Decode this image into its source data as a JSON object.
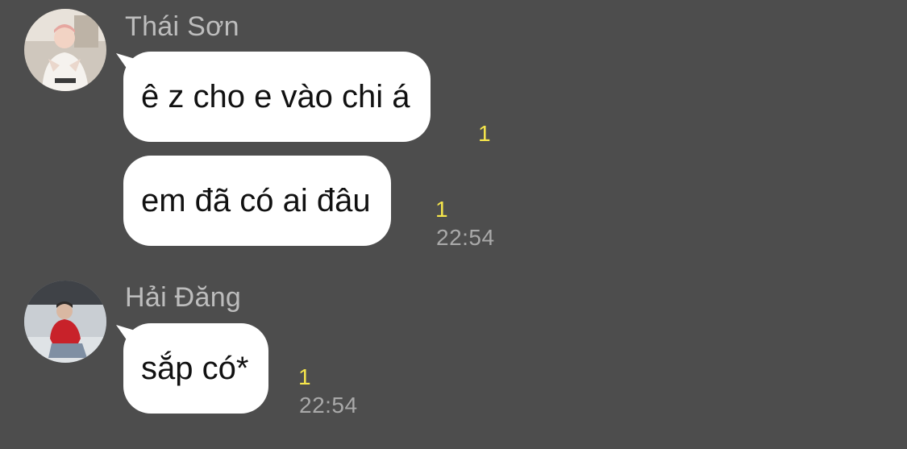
{
  "messages_group_1": {
    "sender": "Thái Sơn",
    "messages": [
      {
        "text": "ê z cho e vào chi á",
        "unread": "1"
      },
      {
        "text": "em đã có ai đâu",
        "unread": "1",
        "time": "22:54"
      }
    ]
  },
  "messages_group_2": {
    "sender": "Hải Đăng",
    "messages": [
      {
        "text": "sắp có*",
        "unread": "1",
        "time": "22:54"
      }
    ]
  },
  "colors": {
    "background": "#4d4d4d",
    "bubble": "#ffffff",
    "unread": "#f6e64b",
    "meta_text": "#a9a9a9"
  },
  "icons": [
    "avatar-thai-son",
    "avatar-hai-dang"
  ]
}
